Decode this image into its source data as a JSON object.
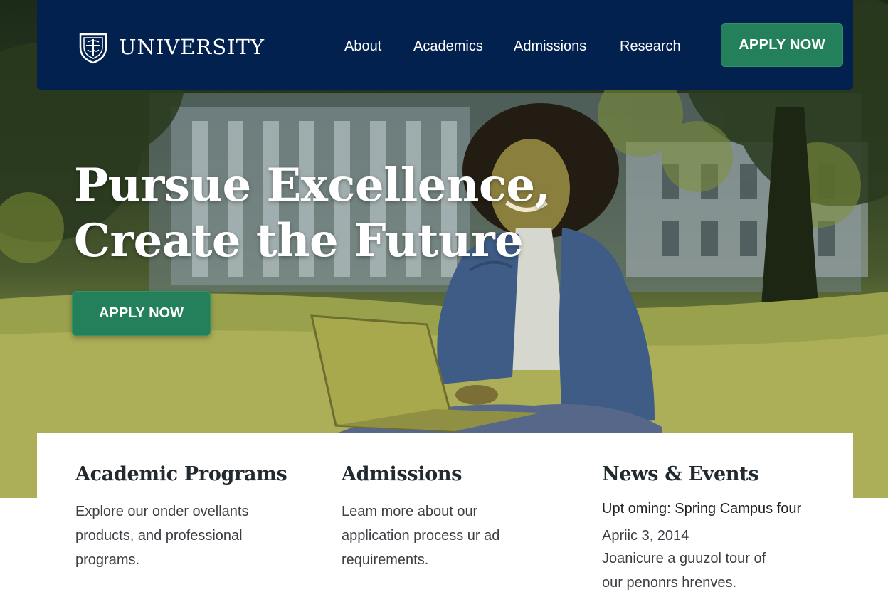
{
  "header": {
    "brand_name": "UNIVERSITY",
    "nav_items": [
      {
        "label": "About"
      },
      {
        "label": "Academics"
      },
      {
        "label": "Admissions"
      },
      {
        "label": "Research"
      }
    ],
    "apply_label": "APPLY NOW"
  },
  "hero": {
    "title_line1": "Pursue Excellence,",
    "title_line2": "Create the Future",
    "apply_label": "APPLY NOW"
  },
  "sections": {
    "programs": {
      "heading": "Academic Programs",
      "lines": [
        "Explore our onder ovellants",
        "products, and professional",
        "programs."
      ]
    },
    "admissions": {
      "heading": "Admissions",
      "lines": [
        "Leam more about our",
        "application process ur ad",
        "requirements."
      ]
    },
    "news": {
      "heading": "News & Events",
      "event_title": "Upt oming: Spring Campus four",
      "event_date": "Apriic 3, 2014",
      "lines": [
        "Joanicure a guuzol tour of",
        "our penonrs hrenves."
      ]
    }
  },
  "colors": {
    "navy": "#02214f",
    "accent_green": "#23805a",
    "heading_text": "#222a30",
    "body_text": "#3b3f44"
  },
  "icons": {
    "brand_logo": "university-shield-icon"
  }
}
